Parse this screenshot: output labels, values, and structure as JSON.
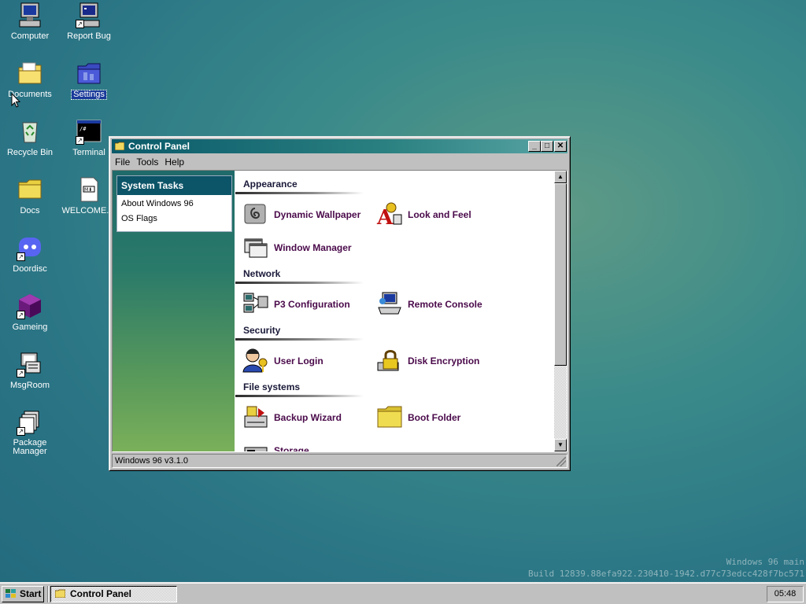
{
  "desktop": {
    "icons": [
      {
        "label": "Computer",
        "icon": "computer-icon"
      },
      {
        "label": "Report Bug",
        "icon": "report-bug-icon"
      },
      {
        "label": "Documents",
        "icon": "documents-folder-icon"
      },
      {
        "label": "Settings",
        "icon": "settings-folder-icon"
      },
      {
        "label": "Recycle Bin",
        "icon": "recycle-bin-icon"
      },
      {
        "label": "Terminal",
        "icon": "terminal-icon"
      },
      {
        "label": "Docs",
        "icon": "folder-icon"
      },
      {
        "label": "WELCOME....",
        "icon": "markdown-file-icon"
      },
      {
        "label": "Doordisc",
        "icon": "doordisc-icon"
      },
      {
        "label": "Gameing",
        "icon": "game-cube-icon"
      },
      {
        "label": "MsgRoom",
        "icon": "msgroom-icon"
      },
      {
        "label": "Package Manager",
        "icon": "package-manager-icon"
      }
    ]
  },
  "window": {
    "title": "Control Panel",
    "buttons": {
      "minimize": "_",
      "maximize": "□",
      "close": "✕"
    },
    "menu": [
      "File",
      "Tools",
      "Help"
    ],
    "system_tasks": {
      "header": "System Tasks",
      "links": [
        "About Windows 96",
        "OS Flags"
      ]
    },
    "sections": [
      {
        "title": "Appearance"
      },
      {
        "title": "Network"
      },
      {
        "title": "Security"
      },
      {
        "title": "File systems"
      }
    ],
    "items": [
      {
        "label": "Dynamic Wallpaper",
        "icon": "dynamic-wallpaper-icon"
      },
      {
        "label": "Look and Feel",
        "icon": "look-and-feel-icon"
      },
      {
        "label": "Window Manager",
        "icon": "window-manager-icon"
      },
      {
        "label": "P3 Configuration",
        "icon": "network-computers-icon"
      },
      {
        "label": "Remote Console",
        "icon": "remote-console-icon"
      },
      {
        "label": "User Login",
        "icon": "user-login-icon"
      },
      {
        "label": "Disk Encryption",
        "icon": "lock-icon"
      },
      {
        "label": "Backup Wizard",
        "icon": "backup-wizard-icon"
      },
      {
        "label": "Boot Folder",
        "icon": "folder-icon"
      },
      {
        "label": "Storage",
        "icon": "storage-drive-icon"
      }
    ],
    "status": "Windows 96 v3.1.0"
  },
  "watermark": {
    "line1": "Windows 96 main",
    "line2": "Build 12839.88efa922.230410-1942.d77c73edcc428f7bc571"
  },
  "taskbar": {
    "start_label": "Start",
    "task_label": "Control Panel",
    "clock": "05:48"
  }
}
